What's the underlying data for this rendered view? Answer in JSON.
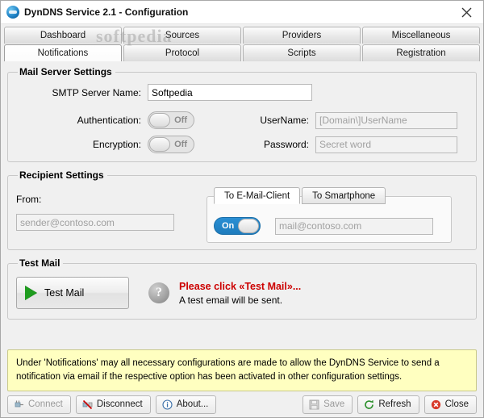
{
  "window": {
    "title": "DynDNS Service 2.1 - Configuration",
    "app_icon": "globe-icon",
    "close_label": "✕",
    "watermark": "softpedia"
  },
  "tabs": {
    "row1": [
      {
        "label": "Dashboard",
        "active": false
      },
      {
        "label": "Sources",
        "active": false
      },
      {
        "label": "Providers",
        "active": false
      },
      {
        "label": "Miscellaneous",
        "active": false
      }
    ],
    "row2": [
      {
        "label": "Notifications",
        "active": true
      },
      {
        "label": "Protocol",
        "active": false
      },
      {
        "label": "Scripts",
        "active": false
      },
      {
        "label": "Registration",
        "active": false
      }
    ]
  },
  "mail_server": {
    "legend": "Mail Server Settings",
    "smtp_label": "SMTP Server Name:",
    "smtp_value": "Softpedia",
    "smtp_placeholder": "",
    "auth_label": "Authentication:",
    "auth_state": "Off",
    "encryption_label": "Encryption:",
    "encryption_state": "Off",
    "username_label": "UserName:",
    "username_value": "",
    "username_placeholder": "[Domain\\]UserName",
    "password_label": "Password:",
    "password_value": "",
    "password_placeholder": "Secret word"
  },
  "recipient": {
    "legend": "Recipient Settings",
    "from_label": "From:",
    "from_value": "",
    "from_placeholder": "sender@contoso.com",
    "inner_tabs": [
      {
        "label": "To E-Mail-Client",
        "active": true
      },
      {
        "label": "To Smartphone",
        "active": false
      }
    ],
    "mail_toggle_state": "On",
    "mail_value": "",
    "mail_placeholder": "mail@contoso.com"
  },
  "test_mail": {
    "legend": "Test Mail",
    "button_label": "Test Mail",
    "button_icon": "play-icon",
    "help_icon": "question-mark-icon",
    "warning_line1": "Please click «Test Mail»...",
    "warning_line2": "A test email will be sent."
  },
  "info_band": {
    "text": "Under 'Notifications' may all necessary configurations are made to allow the DynDNS Service to send a notification via email if the respective option has been activated in other configuration settings."
  },
  "statusbar": {
    "connect": "Connect",
    "connect_icon": "plug-icon",
    "disconnect": "Disconnect",
    "disconnect_icon": "disconnect-icon",
    "about": "About...",
    "about_icon": "info-icon",
    "save": "Save",
    "save_icon": "save-icon",
    "refresh": "Refresh",
    "refresh_icon": "refresh-icon",
    "close": "Close",
    "close_icon": "close-circle-icon"
  },
  "colors": {
    "accent_blue": "#2a8fd4",
    "warning_red": "#cc0000",
    "info_yellow": "#ffffc0",
    "green": "#1f9c1f"
  }
}
